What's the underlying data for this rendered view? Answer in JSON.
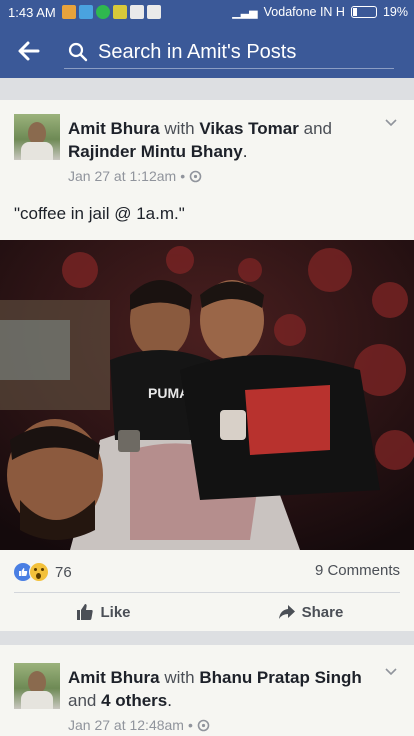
{
  "status_bar": {
    "time": "1:43 AM",
    "carrier": "Vodafone IN H",
    "battery": "19%"
  },
  "search": {
    "placeholder": "Search in Amit's Posts"
  },
  "posts": [
    {
      "author": "Amit Bhura",
      "with_word": "with",
      "tagged_1": "Vikas Tomar",
      "and_word": "and",
      "tagged_2": "Rajinder Mintu Bhany",
      "end_punct": ".",
      "timestamp": "Jan 27 at 1:12am",
      "separator": "•",
      "privacy_icon": "friends-icon",
      "text": "\"coffee in jail @ 1a.m.\"",
      "reaction_count": "76",
      "comments": "9 Comments",
      "like_label": "Like",
      "share_label": "Share"
    },
    {
      "author": "Amit Bhura",
      "with_word": "with",
      "tagged_1": "Bhanu Pratap Singh",
      "and_word": "and",
      "tagged_2": "4 others",
      "end_punct": ".",
      "timestamp": "Jan 27 at 12:48am",
      "separator": "•",
      "privacy_icon": "friends-icon"
    }
  ],
  "colors": {
    "brand": "#3b5998",
    "background": "#dddfe2",
    "card": "#f6f6f2"
  }
}
